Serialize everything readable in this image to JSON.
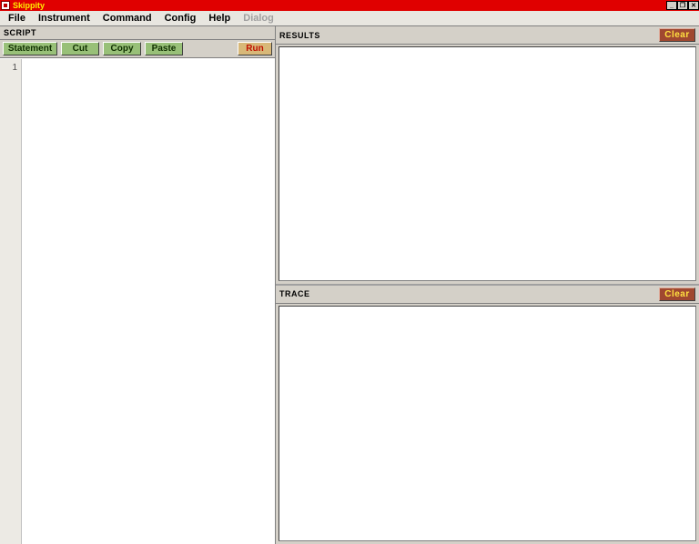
{
  "title": "Skippity",
  "menubar": {
    "items": [
      {
        "label": "File",
        "enabled": true
      },
      {
        "label": "Instrument",
        "enabled": true
      },
      {
        "label": "Command",
        "enabled": true
      },
      {
        "label": "Config",
        "enabled": true
      },
      {
        "label": "Help",
        "enabled": true
      },
      {
        "label": "Dialog",
        "enabled": false
      }
    ]
  },
  "script": {
    "title": "SCRIPT",
    "toolbar": {
      "statement": "Statement",
      "cut": "Cut",
      "copy": "Copy",
      "paste": "Paste",
      "run": "Run"
    },
    "gutter_line1": "1",
    "content": ""
  },
  "results": {
    "title": "RESULTS",
    "clear": "Clear",
    "content": ""
  },
  "trace": {
    "title": "TRACE",
    "clear": "Clear",
    "content": ""
  },
  "window_controls": {
    "minimize": "_",
    "maximize": "❐",
    "close": "✕"
  }
}
